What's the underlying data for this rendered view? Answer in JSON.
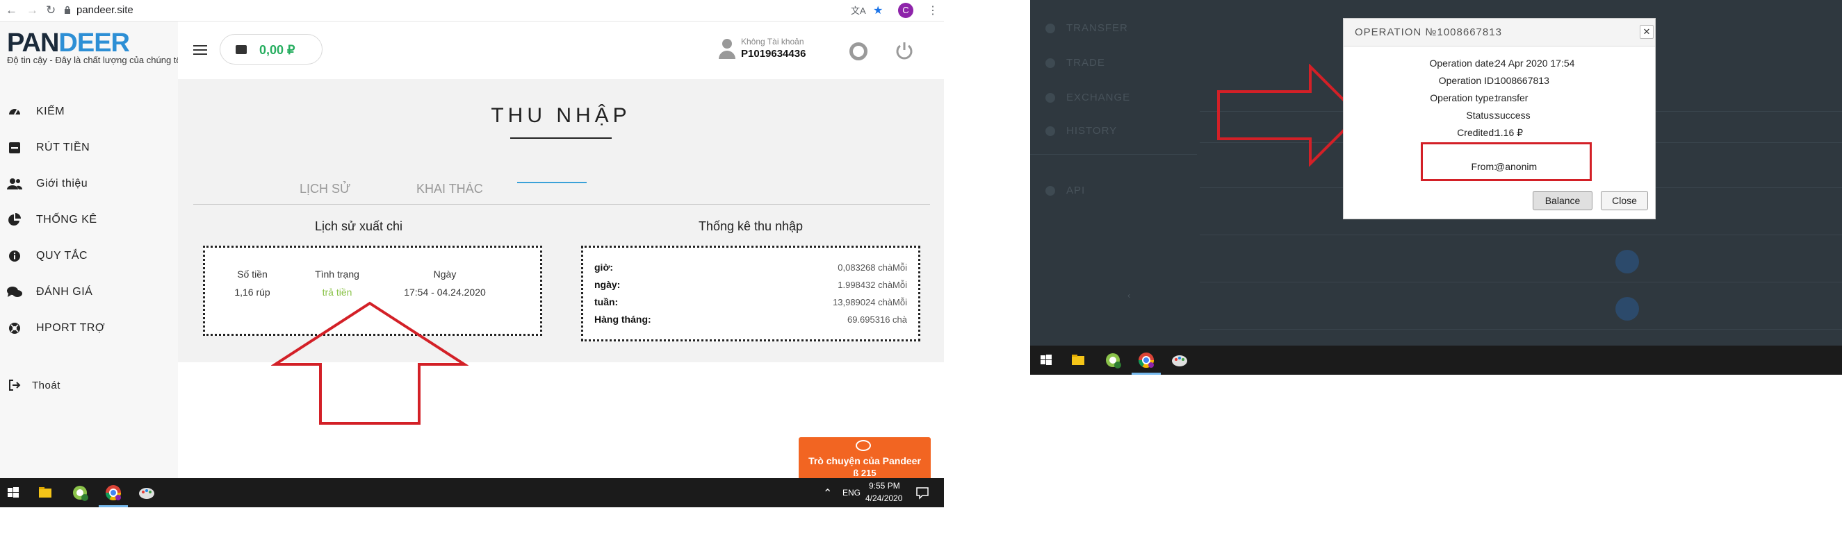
{
  "left_screen": {
    "browser": {
      "url": "pandeer.site",
      "profile_initial": "C"
    },
    "logo": {
      "part1": "PAN",
      "part2": "DEER",
      "tagline": "Độ tin cậy - Đây là chất lượng của chúng tôi!"
    },
    "sidebar": {
      "items": [
        {
          "label": "KIẾM",
          "icon": "speedometer-icon"
        },
        {
          "label": "RÚT TIỀN",
          "icon": "minus-square-icon"
        },
        {
          "label": "Giới thiệu",
          "icon": "users-icon"
        },
        {
          "label": "THỐNG KÊ",
          "icon": "pie-chart-icon"
        },
        {
          "label": "QUY TẮC",
          "icon": "info-icon"
        },
        {
          "label": "ĐÁNH GIÁ",
          "icon": "comments-icon"
        },
        {
          "label": "HPORT TRỢ",
          "icon": "lifebuoy-icon"
        }
      ],
      "logout": "Thoát"
    },
    "topbar": {
      "balance": "0,00 ₽",
      "account_label": "Không Tài khoản",
      "account_id": "P1019634436"
    },
    "page": {
      "title": "THU NHẬP",
      "tabs": [
        "LỊCH SỬ",
        "KHAI THÁC"
      ],
      "history_panel": {
        "title": "Lịch sử xuất chi",
        "headers": [
          "Số tiền",
          "Tình trạng",
          "Ngày"
        ],
        "row": [
          "1,16 rúp",
          "trả tiền",
          "17:54 - 04.24.2020"
        ]
      },
      "stats_panel": {
        "title": "Thống kê thu nhập",
        "rows": [
          {
            "label": "giờ:",
            "value": "0,083268 chàMỗi"
          },
          {
            "label": "ngày:",
            "value": "1.998432 chàMỗi"
          },
          {
            "label": "tuần:",
            "value": "13,989024 chàMỗi"
          },
          {
            "label": "Hàng tháng:",
            "value": "69.695316 chà"
          }
        ]
      }
    },
    "chat": {
      "label": "Trò chuyện của Pandeer",
      "count": "ß 215"
    },
    "taskbar": {
      "lang": "ENG",
      "time": "9:55 PM",
      "date": "4/24/2020"
    },
    "annotation_color": "#d32027"
  },
  "right_screen": {
    "background_menu": [
      "TRANSFER",
      "TRADE",
      "EXCHANGE",
      "HISTORY",
      "API"
    ],
    "modal": {
      "title": "OPERATION №1008667813",
      "rows": [
        {
          "label": "Operation date:",
          "value": "24 Apr 2020 17:54"
        },
        {
          "label": "Operation ID:",
          "value": "1008667813"
        },
        {
          "label": "Operation type:",
          "value": "transfer"
        },
        {
          "label": "Status:",
          "value": "success"
        },
        {
          "label": "Credited:",
          "value": "1.16 ₽"
        }
      ],
      "from_label": "From:",
      "from_value": "@anonim",
      "balance_button": "Balance",
      "close_button": "Close"
    }
  }
}
